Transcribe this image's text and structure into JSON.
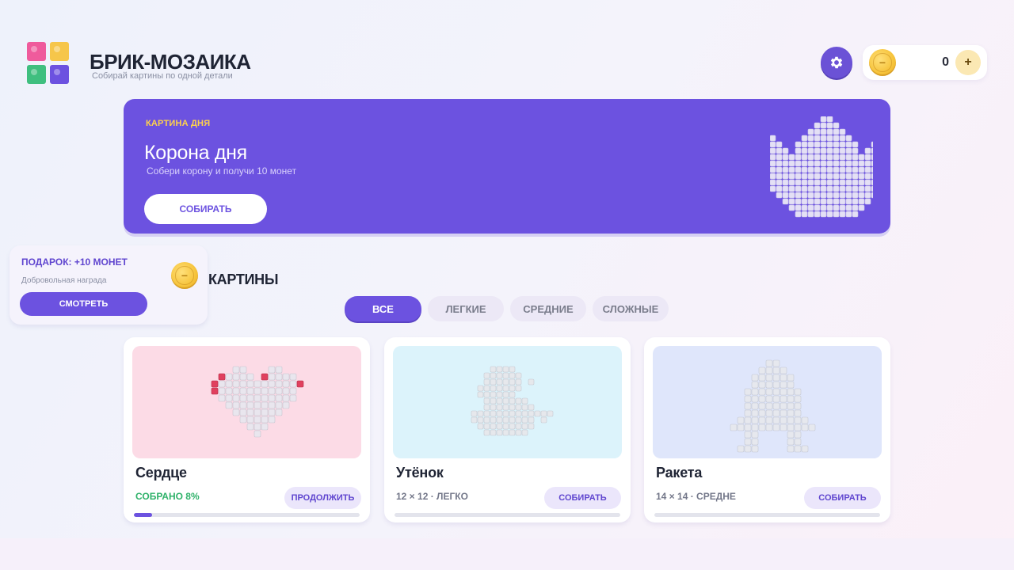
{
  "app": {
    "title": "БРИК-МОЗАИКА",
    "subtitle": "Собирай картины по одной детали",
    "logo_colors": [
      "#ef5b9c",
      "#f6c64a",
      "#3fbf7f",
      "#6c52e0"
    ]
  },
  "header": {
    "settings_icon": "gear-icon",
    "coins": "0",
    "coin_icon": "coin-icon",
    "add_coins_label": "+"
  },
  "banner": {
    "label": "КАРТИНА ДНЯ",
    "title": "Корона дня",
    "subtitle": "Собери корону и получи 10 монет",
    "button_label": "СОБИРАТЬ",
    "image_icon": "crown-mosaic"
  },
  "gift": {
    "title": "ПОДАРОК: +10 МОНЕТ",
    "subtitle": "Добровольная награда",
    "button_label": "СМОТРЕТЬ"
  },
  "section": {
    "title": "КАРТИНЫ"
  },
  "filters": [
    {
      "label": "ВСЕ",
      "active": true
    },
    {
      "label": "ЛЕГКИЕ",
      "active": false
    },
    {
      "label": "СРЕДНИЕ",
      "active": false
    },
    {
      "label": "СЛОЖНЫЕ",
      "active": false
    }
  ],
  "cards": [
    {
      "name": "Сердце",
      "meta": "СОБРАНО 8%",
      "button_label": "ПРОДОЛЖИТЬ",
      "progress": 0.08,
      "preview_color": "#fcdbe6",
      "image_icon": "heart-mosaic"
    },
    {
      "name": "Утёнок",
      "meta": "12 × 12 · ЛЕГКО",
      "button_label": "СОБИРАТЬ",
      "progress": 0,
      "preview_color": "#dcf3fb",
      "image_icon": "duck-mosaic"
    },
    {
      "name": "Ракета",
      "meta": "14 × 14 · СРЕДНЕ",
      "button_label": "СОБИРАТЬ",
      "progress": 0,
      "preview_color": "#dfe6fb",
      "image_icon": "rocket-mosaic"
    }
  ],
  "colors": {
    "accent": "#6c52e0",
    "coin": "#f6c33a",
    "progress_green": "#2fb26a",
    "heart_red": "#e0405e"
  }
}
